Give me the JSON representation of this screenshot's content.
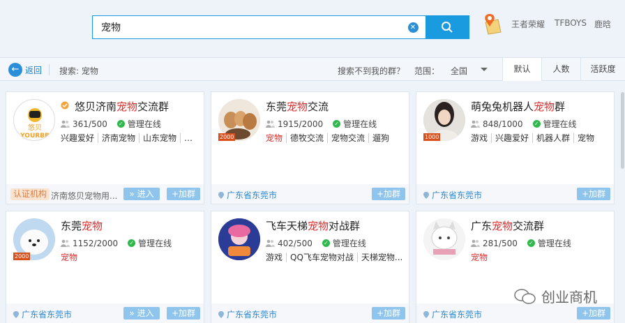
{
  "search": {
    "value": "宠物"
  },
  "hot_links": [
    "王者荣耀",
    "TFBOYS",
    "鹿晗"
  ],
  "filter": {
    "back_label": "返回",
    "query_text": "搜索: 宠物",
    "not_found": "搜索不到我的群？",
    "range_label": "范围：",
    "range_value": "全国",
    "sort_tabs": [
      "默认",
      "人数",
      "活跃度"
    ]
  },
  "cards": [
    {
      "title_pre": "悠贝济南",
      "title_hl": "宠物",
      "title_post": "交流群",
      "members": "361/500",
      "admin": "管理在线",
      "tags": [
        {
          "t": "兴趣爱好"
        },
        {
          "t": "济南宠物"
        },
        {
          "t": "山东宠物"
        },
        {
          "t": "…"
        }
      ],
      "cert": "认证机构",
      "cert_text": "济南悠贝宠物用...",
      "enter": "进入",
      "join": "+加群",
      "avatar_text": "悠贝",
      "avatar_sub": "YOURBB"
    },
    {
      "title_pre": "东莞",
      "title_hl": "宠物",
      "title_post": "交流",
      "members": "1915/2000",
      "admin": "管理在线",
      "level": "2000",
      "tags": [
        {
          "t": "宠物",
          "red": true
        },
        {
          "t": "德牧交流"
        },
        {
          "t": "宠物交流"
        },
        {
          "t": "遛狗"
        }
      ],
      "location": "广东省东莞市",
      "join": "+加群"
    },
    {
      "title_pre": "萌兔兔机器人",
      "title_hl": "宠物",
      "title_post": "群",
      "members": "848/1000",
      "admin": "管理在线",
      "level": "1000",
      "tags": [
        {
          "t": "游戏"
        },
        {
          "t": "兴趣爱好"
        },
        {
          "t": "机器人群"
        },
        {
          "t": "宠物"
        }
      ],
      "location": "广东省东莞市",
      "join": "+加群"
    },
    {
      "title_pre": "东莞",
      "title_hl": "宠物",
      "title_post": "",
      "members": "1152/2000",
      "admin": "管理在线",
      "level": "2000",
      "tags": [
        {
          "t": "宠物",
          "red": true
        }
      ],
      "location": "广东省东莞市",
      "enter": "进入",
      "join": "+加群"
    },
    {
      "title_pre": "飞车天梯",
      "title_hl": "宠物",
      "title_post": "对战群",
      "members": "402/500",
      "admin": "管理在线",
      "tags": [
        {
          "t": "游戏"
        },
        {
          "t": "QQ飞车宠物对战"
        },
        {
          "t": "天梯宠物..."
        }
      ],
      "location": "广东省东莞市",
      "join": "+加群"
    },
    {
      "title_pre": "广东",
      "title_hl": "宠物",
      "title_post": "交流群",
      "members": "281/500",
      "admin": "管理在线",
      "tags": [
        {
          "t": "宠物",
          "red": true
        }
      ],
      "location": "广东省东莞市",
      "join": "+加群"
    }
  ],
  "watermark": "创业商机",
  "colors": {
    "accent": "#1a9be0",
    "highlight": "#e02a2a",
    "online": "#2fb84b"
  }
}
